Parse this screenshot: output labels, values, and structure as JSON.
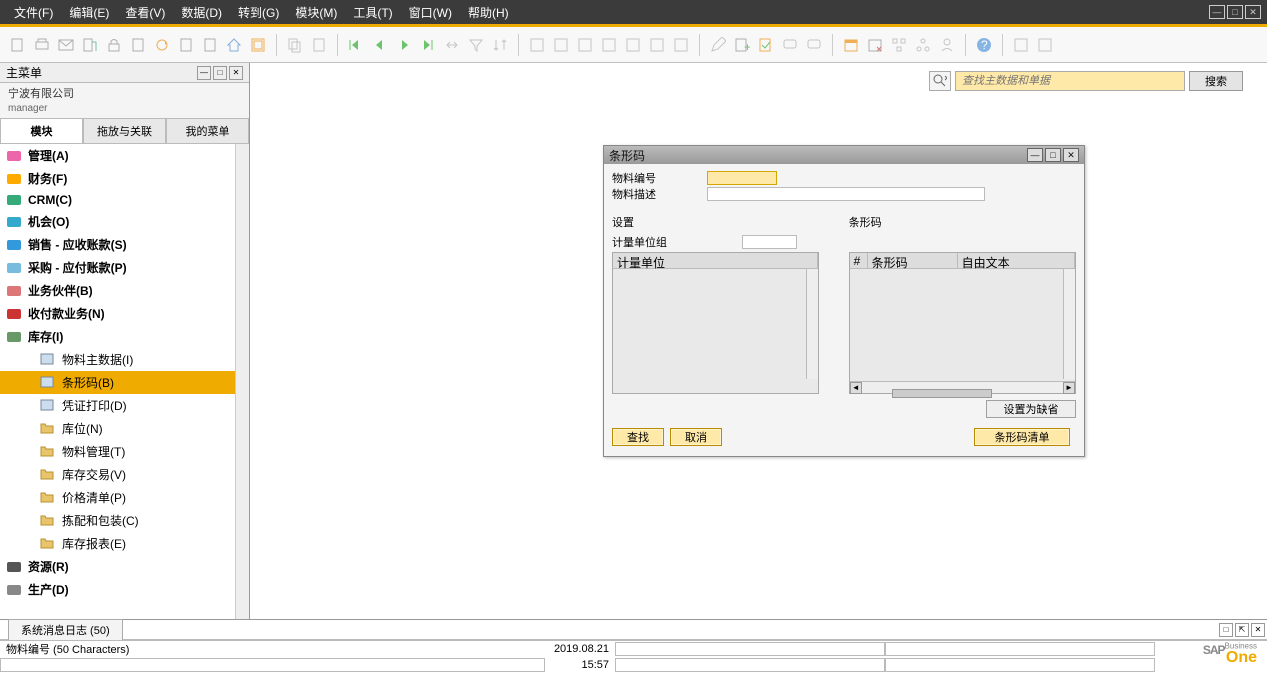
{
  "menu": [
    "文件(F)",
    "编辑(E)",
    "查看(V)",
    "数据(D)",
    "转到(G)",
    "模块(M)",
    "工具(T)",
    "窗口(W)",
    "帮助(H)"
  ],
  "panel": {
    "title": "主菜单",
    "company": "宁波有限公司",
    "user": "manager"
  },
  "tabs": [
    "模块",
    "拖放与关联",
    "我的菜单"
  ],
  "tree": [
    {
      "label": "管理(A)",
      "level": 1,
      "icon": "admin"
    },
    {
      "label": "财务(F)",
      "level": 1,
      "icon": "finance"
    },
    {
      "label": "CRM(C)",
      "level": 1,
      "icon": "crm"
    },
    {
      "label": "机会(O)",
      "level": 1,
      "icon": "opp"
    },
    {
      "label": "销售 - 应收账款(S)",
      "level": 1,
      "icon": "sales"
    },
    {
      "label": "采购 - 应付账款(P)",
      "level": 1,
      "icon": "purchase"
    },
    {
      "label": "业务伙伴(B)",
      "level": 1,
      "icon": "bp"
    },
    {
      "label": "收付款业务(N)",
      "level": 1,
      "icon": "bank"
    },
    {
      "label": "库存(I)",
      "level": 1,
      "icon": "inventory"
    },
    {
      "label": "物料主数据(I)",
      "level": 2
    },
    {
      "label": "条形码(B)",
      "level": 2,
      "selected": true
    },
    {
      "label": "凭证打印(D)",
      "level": 2
    },
    {
      "label": "库位(N)",
      "level": 2,
      "folder": true
    },
    {
      "label": "物料管理(T)",
      "level": 2,
      "folder": true
    },
    {
      "label": "库存交易(V)",
      "level": 2,
      "folder": true
    },
    {
      "label": "价格清单(P)",
      "level": 2,
      "folder": true
    },
    {
      "label": "拣配和包装(C)",
      "level": 2,
      "folder": true
    },
    {
      "label": "库存报表(E)",
      "level": 2,
      "folder": true
    },
    {
      "label": "资源(R)",
      "level": 1,
      "icon": "resource"
    },
    {
      "label": "生产(D)",
      "level": 1,
      "icon": "production"
    }
  ],
  "search": {
    "placeholder": "查找主数据和单据",
    "button": "搜索"
  },
  "dialog": {
    "title": "条形码",
    "item_no_label": "物料编号",
    "item_desc_label": "物料描述",
    "settings_label": "设置",
    "uom_group_label": "计量单位组",
    "uom_header": "计量单位",
    "barcode_section": "条形码",
    "bc_col_num": "#",
    "bc_col_barcode": "条形码",
    "bc_col_freetext": "自由文本",
    "set_default": "设置为缺省",
    "find": "查找",
    "cancel": "取消",
    "barcode_list": "条形码清单"
  },
  "bottom_tab": "系统消息日志 (50)",
  "status": {
    "field_info": "物料编号 (50 Characters)",
    "date": "2019.08.21",
    "time": "15:57"
  },
  "logo": {
    "sap": "SAP",
    "business": "Business",
    "one": "One"
  }
}
